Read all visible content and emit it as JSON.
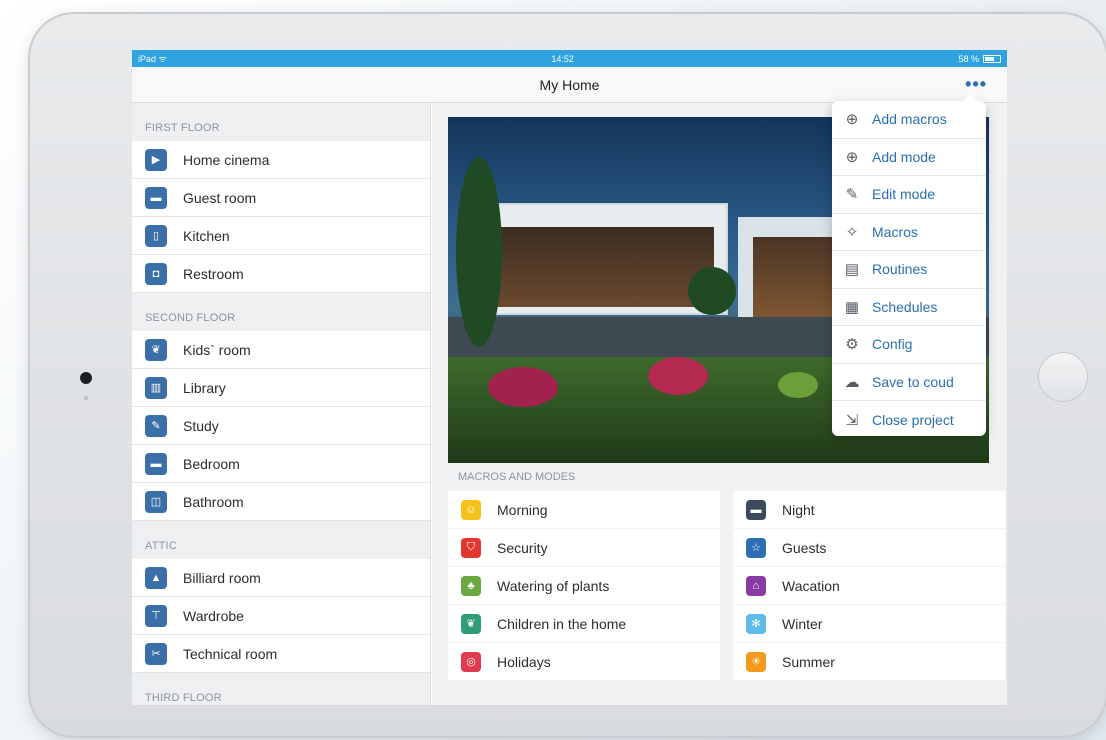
{
  "status_bar": {
    "left": "iPad ᯤ",
    "time": "14:52",
    "battery": "58 %"
  },
  "nav": {
    "title": "My Home",
    "more_icon": "•••"
  },
  "sidebar": {
    "sections": [
      {
        "header": "FIRST FLOOR",
        "rooms": [
          {
            "label": "Home cinema",
            "icon": "cinema-icon"
          },
          {
            "label": "Guest room",
            "icon": "bed-icon"
          },
          {
            "label": "Kitchen",
            "icon": "fridge-icon"
          },
          {
            "label": "Restroom",
            "icon": "toilet-icon"
          }
        ]
      },
      {
        "header": "SECOND FLOOR",
        "rooms": [
          {
            "label": "Kids` room",
            "icon": "teddy-bear-icon"
          },
          {
            "label": "Library",
            "icon": "books-icon"
          },
          {
            "label": "Study",
            "icon": "pen-icon"
          },
          {
            "label": "Bedroom",
            "icon": "bed-icon"
          },
          {
            "label": "Bathroom",
            "icon": "bath-icon"
          }
        ]
      },
      {
        "header": "ATTIC",
        "rooms": [
          {
            "label": "Billiard room",
            "icon": "billiard-triangle-icon"
          },
          {
            "label": "Wardrobe",
            "icon": "shirt-icon"
          },
          {
            "label": "Technical room",
            "icon": "tools-icon"
          }
        ]
      },
      {
        "header": "THIRD FLOOR",
        "rooms": []
      }
    ]
  },
  "macros": {
    "header": "MACROS AND MODES",
    "left": [
      {
        "label": "Morning",
        "icon": "sun-face-icon",
        "color": "#f5c21b"
      },
      {
        "label": "Security",
        "icon": "shield-icon",
        "color": "#e2372f"
      },
      {
        "label": "Watering of plants",
        "icon": "plant-icon",
        "color": "#6aa842"
      },
      {
        "label": "Children in the home",
        "icon": "teddy-bear-icon",
        "color": "#2f9e78"
      },
      {
        "label": "Holidays",
        "icon": "balloon-icon",
        "color": "#e23a4f"
      }
    ],
    "right": [
      {
        "label": "Night",
        "icon": "bed-icon",
        "color": "#3b4a5c"
      },
      {
        "label": "Guests",
        "icon": "star-icon",
        "color": "#2e6fb3"
      },
      {
        "label": "Wacation",
        "icon": "suitcase-icon",
        "color": "#8a3aa3"
      },
      {
        "label": "Winter",
        "icon": "snowflake-icon",
        "color": "#5fbbe9"
      },
      {
        "label": "Summer",
        "icon": "sun-icon",
        "color": "#f39a1e"
      }
    ]
  },
  "menu": {
    "items": [
      {
        "label": "Add macros",
        "icon": "plus-circle-icon",
        "glyph": "⊕"
      },
      {
        "label": "Add mode",
        "icon": "plus-circle-icon",
        "glyph": "⊕"
      },
      {
        "label": "Edit mode",
        "icon": "edit-icon",
        "glyph": "✎"
      },
      {
        "label": "Macros",
        "icon": "magic-wand-icon",
        "glyph": "✧"
      },
      {
        "label": "Routines",
        "icon": "document-icon",
        "glyph": "▤"
      },
      {
        "label": "Schedules",
        "icon": "calendar-icon",
        "glyph": "▦"
      },
      {
        "label": "Config",
        "icon": "gear-icon",
        "glyph": "⚙"
      },
      {
        "label": "Save to coud",
        "icon": "cloud-upload-icon",
        "glyph": "☁"
      },
      {
        "label": "Close project",
        "icon": "exit-icon",
        "glyph": "⇲"
      }
    ]
  }
}
